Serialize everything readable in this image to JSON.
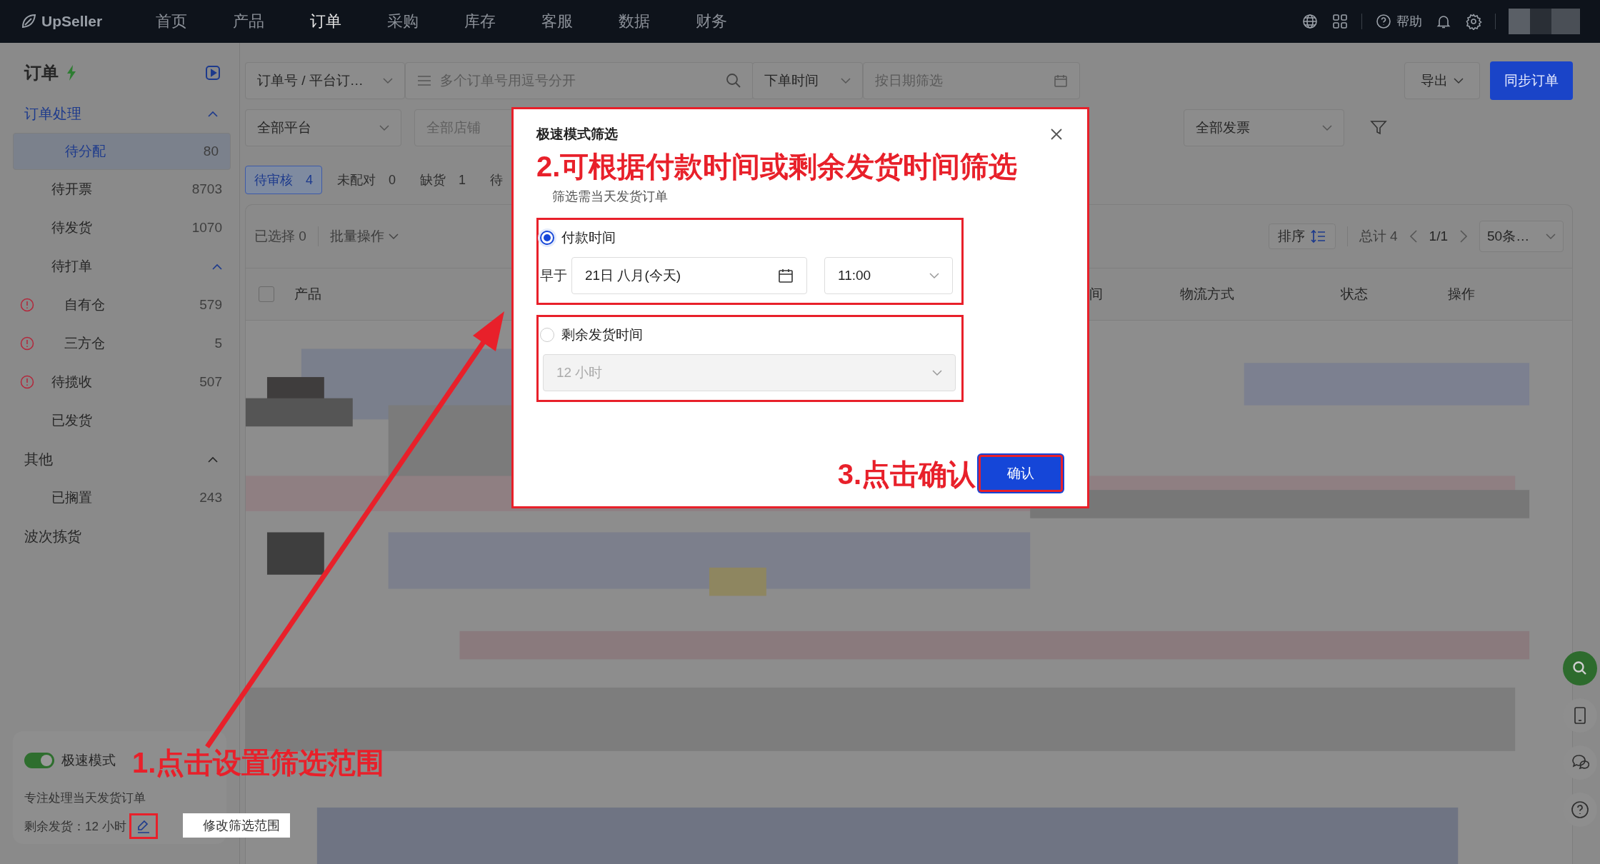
{
  "nav": {
    "logo": "UpSeller",
    "menu": [
      {
        "label": "首页",
        "selected": false
      },
      {
        "label": "产品",
        "selected": false
      },
      {
        "label": "订单",
        "selected": true
      },
      {
        "label": "采购",
        "selected": false
      },
      {
        "label": "库存",
        "selected": false
      },
      {
        "label": "客服",
        "selected": false
      },
      {
        "label": "数据",
        "selected": false
      },
      {
        "label": "财务",
        "selected": false
      }
    ],
    "help": "帮助"
  },
  "sidebar": {
    "title": "订单",
    "items": [
      {
        "label": "订单处理",
        "active": true,
        "expanded": true,
        "children": [
          {
            "label": "待分配",
            "count": "80",
            "selected": true,
            "warning": false
          },
          {
            "label": "待开票",
            "count": "8703",
            "selected": false,
            "warning": false
          },
          {
            "label": "待发货",
            "count": "1070",
            "selected": false,
            "warning": false
          },
          {
            "label": "待打单",
            "selected": false,
            "warning": false,
            "expanded": true,
            "children": [
              {
                "label": "自有仓",
                "count": "579",
                "selected": false,
                "warning": true
              },
              {
                "label": "三方仓",
                "count": "5",
                "selected": false,
                "warning": true
              }
            ]
          },
          {
            "label": "待揽收",
            "count": "507",
            "selected": false,
            "warning": true
          },
          {
            "label": "已发货",
            "selected": false,
            "warning": false
          }
        ]
      },
      {
        "label": "其他",
        "active": false,
        "expanded": true,
        "children": [
          {
            "label": "已搁置",
            "count": "243",
            "selected": false,
            "warning": false
          }
        ]
      },
      {
        "label": "波次拣货",
        "active": false
      }
    ]
  },
  "speed_mode": {
    "label": "极速模式",
    "on": true,
    "description": "专注处理当天发货订单",
    "setting": "剩余发货：12 小时",
    "tooltip": "修改筛选范围"
  },
  "filters": {
    "search_type": "订单号 / 平台订…",
    "search_placeholder": "多个订单号用逗号分开",
    "date_type": "下单时间",
    "date_placeholder": "按日期筛选",
    "export": "导出",
    "sync": "同步订单",
    "platform": "全部平台",
    "store": "全部店铺",
    "invoice": "全部发票"
  },
  "tabs": [
    {
      "label": "待审核",
      "count": "4",
      "selected": true
    },
    {
      "label": "未配对",
      "count": "0",
      "selected": false
    },
    {
      "label": "缺货",
      "count": "1",
      "selected": false
    },
    {
      "label": "待",
      "selected": false
    }
  ],
  "toolbar": {
    "selected": "已选择 0",
    "batch": "批量操作",
    "sort": "排序",
    "total": "总计 4",
    "page": "1/1",
    "page_size": "50条…"
  },
  "table": {
    "select_all": false,
    "columns": [
      "产品",
      "间",
      "物流方式",
      "状态",
      "操作"
    ]
  },
  "modal": {
    "title": "极速模式筛选",
    "subtitle": "筛选需当天发货订单",
    "options": [
      {
        "kind": "date",
        "label": "付款时间",
        "selected": true,
        "prefix": "早于",
        "date": "21日 八月(今天)",
        "time": "11:00"
      },
      {
        "kind": "select",
        "label": "剩余发货时间",
        "selected": false,
        "value": "12 小时"
      }
    ],
    "confirm": "确认"
  },
  "annotations": [
    "1.点击设置筛选范围",
    "2.可根据付款时间或剩余发货时间筛选",
    "3.点击确认"
  ]
}
